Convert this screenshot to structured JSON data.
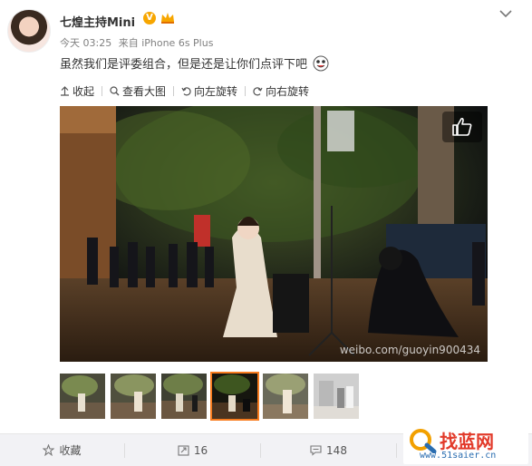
{
  "post": {
    "username": "七煌主持Mini",
    "verified_badge": "V",
    "timestamp": "今天 03:25",
    "source": "来自 iPhone 6s Plus",
    "text": "虽然我们是评委组合，但是还是让你们点评下吧"
  },
  "toolbar": {
    "collapse": "收起",
    "view_large": "查看大图",
    "rotate_left": "向左旋转",
    "rotate_right": "向右旋转"
  },
  "photo": {
    "watermark": "weibo.com/guoyin900434"
  },
  "thumbnails": {
    "count": 6,
    "active_index": 3
  },
  "actions": {
    "favorite": "收藏",
    "repost_count": "16",
    "comment_count": "148"
  },
  "site_logo": {
    "name": "找蓝网",
    "url": "www.51saier.cn"
  },
  "icons": [
    "chevron-down-icon",
    "crown-icon",
    "collapse-icon",
    "magnify-icon",
    "rotate-left-icon",
    "rotate-right-icon",
    "thumbs-up-icon",
    "star-icon",
    "repost-icon",
    "comment-icon"
  ],
  "colors": {
    "accent_orange": "#f77c1f",
    "verified": "#f7a600",
    "bar_bg": "#f2f2f5"
  }
}
